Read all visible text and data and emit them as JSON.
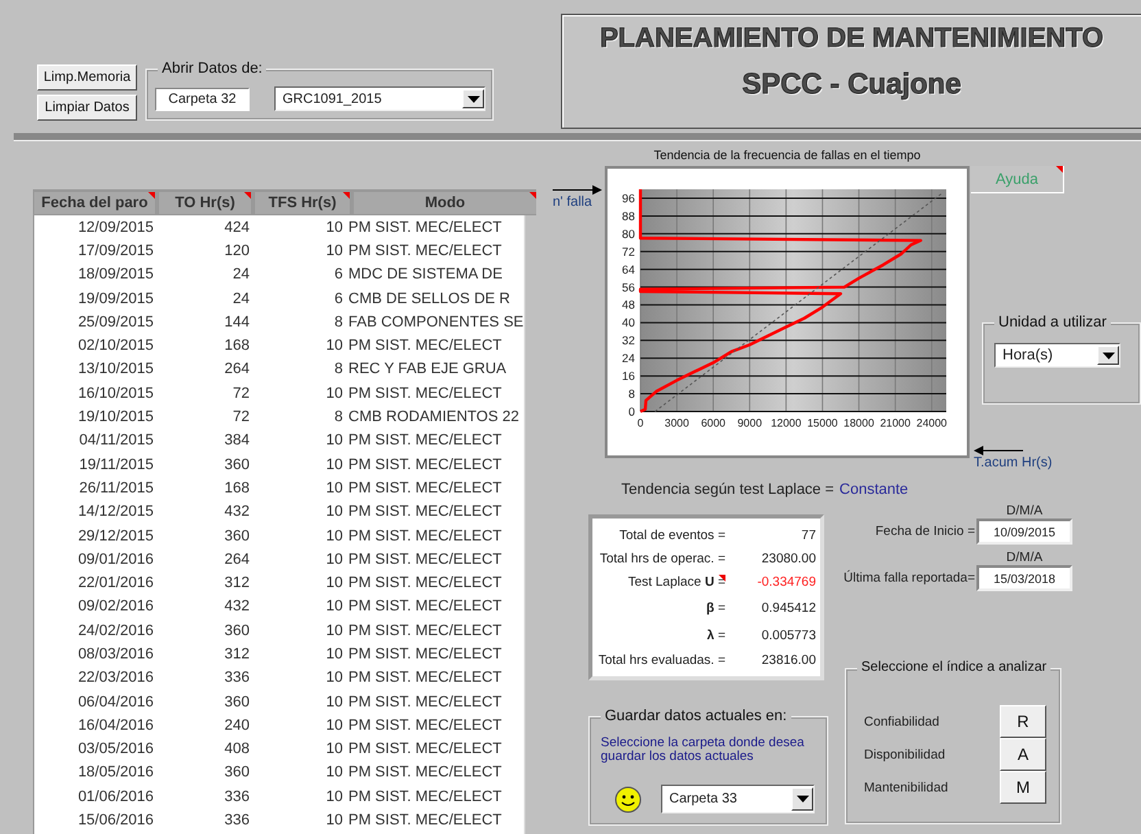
{
  "toolbar": {
    "buttons": [
      "Limp.Memoria",
      "Limpiar Datos"
    ],
    "open_group": {
      "title": "Abrir Datos de:",
      "folder": "Carpeta 32",
      "file": "GRC1091_2015"
    }
  },
  "banner": {
    "title": "PLANEAMIENTO DE MANTENIMIENTO",
    "subtitle": "SPCC - Cuajone"
  },
  "table": {
    "columns": [
      {
        "label": "Fecha del paro",
        "comment": true
      },
      {
        "label": "TO Hr(s)",
        "comment": true
      },
      {
        "label": "TFS Hr(s)",
        "comment": true
      },
      {
        "label": "Modo",
        "comment": true
      }
    ],
    "rows": [
      [
        "12/09/2015",
        "424",
        "10",
        "PM SIST. MEC/ELECT"
      ],
      [
        "17/09/2015",
        "120",
        "10",
        "PM SIST. MEC/ELECT"
      ],
      [
        "18/09/2015",
        "24",
        "6",
        "MDC DE SISTEMA DE"
      ],
      [
        "19/09/2015",
        "24",
        "6",
        "CMB DE SELLOS DE R"
      ],
      [
        "25/09/2015",
        "144",
        "8",
        "FAB COMPONENTES SE"
      ],
      [
        "02/10/2015",
        "168",
        "10",
        "PM SIST. MEC/ELECT"
      ],
      [
        "13/10/2015",
        "264",
        "8",
        "REC Y FAB EJE GRUA"
      ],
      [
        "16/10/2015",
        "72",
        "10",
        "PM SIST. MEC/ELECT"
      ],
      [
        "19/10/2015",
        "72",
        "8",
        "CMB RODAMIENTOS 22"
      ],
      [
        "04/11/2015",
        "384",
        "10",
        "PM SIST. MEC/ELECT"
      ],
      [
        "19/11/2015",
        "360",
        "10",
        "PM SIST. MEC/ELECT"
      ],
      [
        "26/11/2015",
        "168",
        "10",
        "PM SIST. MEC/ELECT"
      ],
      [
        "14/12/2015",
        "432",
        "10",
        "PM SIST. MEC/ELECT"
      ],
      [
        "29/12/2015",
        "360",
        "10",
        "PM SIST. MEC/ELECT"
      ],
      [
        "09/01/2016",
        "264",
        "10",
        "PM SIST. MEC/ELECT"
      ],
      [
        "22/01/2016",
        "312",
        "10",
        "PM SIST. MEC/ELECT"
      ],
      [
        "09/02/2016",
        "432",
        "10",
        "PM SIST. MEC/ELECT"
      ],
      [
        "24/02/2016",
        "360",
        "10",
        "PM SIST. MEC/ELECT"
      ],
      [
        "08/03/2016",
        "312",
        "10",
        "PM SIST. MEC/ELECT"
      ],
      [
        "22/03/2016",
        "336",
        "10",
        "PM SIST. MEC/ELECT"
      ],
      [
        "06/04/2016",
        "360",
        "10",
        "PM SIST. MEC/ELECT"
      ],
      [
        "16/04/2016",
        "240",
        "10",
        "PM SIST. MEC/ELECT"
      ],
      [
        "03/05/2016",
        "408",
        "10",
        "PM SIST. MEC/ELECT"
      ],
      [
        "18/05/2016",
        "360",
        "10",
        "PM SIST. MEC/ELECT"
      ],
      [
        "01/06/2016",
        "336",
        "10",
        "PM SIST. MEC/ELECT"
      ],
      [
        "15/06/2016",
        "336",
        "10",
        "PM SIST. MEC/ELECT"
      ]
    ]
  },
  "chart": {
    "chart_data": {
      "type": "line",
      "title": "Tendencia de la frecuencia de fallas en el tiempo",
      "xlabel": "T.acum Hr(s)",
      "ylabel": "n' falla",
      "x": [
        0,
        400,
        450,
        1300,
        3000,
        4500,
        6000,
        7500,
        9000,
        10500,
        12000,
        13500,
        15000,
        16500,
        0,
        0,
        16800,
        18000,
        20000,
        21500,
        22300,
        23100,
        0,
        0,
        1200,
        24800
      ],
      "series": [
        {
          "color": "#ff0000",
          "values": [
            0,
            1,
            5,
            9,
            14,
            18,
            22,
            27,
            30,
            34,
            38,
            42,
            47,
            53,
            54,
            55,
            56,
            60,
            66,
            71,
            75,
            77,
            78,
            100,
            null,
            null
          ]
        },
        {
          "color": "#555555",
          "line_style": "dashed",
          "values": [
            null,
            null,
            null,
            null,
            null,
            null,
            null,
            null,
            null,
            null,
            null,
            null,
            null,
            null,
            null,
            null,
            null,
            null,
            null,
            null,
            null,
            null,
            null,
            null,
            0,
            98
          ]
        }
      ],
      "xlim": [
        0,
        25200
      ],
      "ylim": [
        0,
        100
      ],
      "xticks": [
        0,
        3000,
        6000,
        9000,
        12000,
        15000,
        18000,
        21000,
        24000
      ],
      "yticks": [
        0,
        8,
        16,
        24,
        32,
        40,
        48,
        56,
        64,
        72,
        80,
        88,
        96
      ],
      "grid": true
    }
  },
  "help_button": {
    "label": "Ayuda",
    "comment": true
  },
  "unit_group": {
    "title": "Unidad a utilizar",
    "value": "Hora(s)"
  },
  "trend": {
    "label": "Tendencia según test Laplace =",
    "value": "Constante"
  },
  "stats": [
    {
      "label": "Total de eventos =",
      "value": "77",
      "kind": "plain",
      "comment": false
    },
    {
      "label": "Total hrs de operac. =",
      "value": "23080.00",
      "kind": "plain",
      "comment": false
    },
    {
      "label": "Test Laplace **U** =",
      "value": "-0.334769",
      "kind": "alert",
      "comment": true
    },
    {
      "label": "**β** =",
      "value": "0.945412",
      "kind": "plain",
      "comment": false
    },
    {
      "label": "**λ** =",
      "value": "0.005773",
      "kind": "plain",
      "comment": false
    },
    {
      "label": "Total hrs evaluadas. =",
      "value": "23816.00",
      "kind": "plain",
      "comment": false
    }
  ],
  "dates": [
    {
      "format": "D/M/A",
      "label": "Fecha de Inicio =",
      "value": "10/09/2015"
    },
    {
      "format": "D/M/A",
      "label": "Última falla reportada=",
      "value": "15/03/2018"
    }
  ],
  "save_group": {
    "title": "Guardar datos actuales en:",
    "message": "Seleccione la carpeta donde desea guardar los datos actuales",
    "folder": "Carpeta 33"
  },
  "index_group": {
    "title": "Seleccione el índice a analizar",
    "items": [
      {
        "label": "Confiabilidad",
        "button": "R"
      },
      {
        "label": "Disponibilidad",
        "button": "A"
      },
      {
        "label": "Mantenibilidad",
        "button": "M"
      }
    ]
  }
}
